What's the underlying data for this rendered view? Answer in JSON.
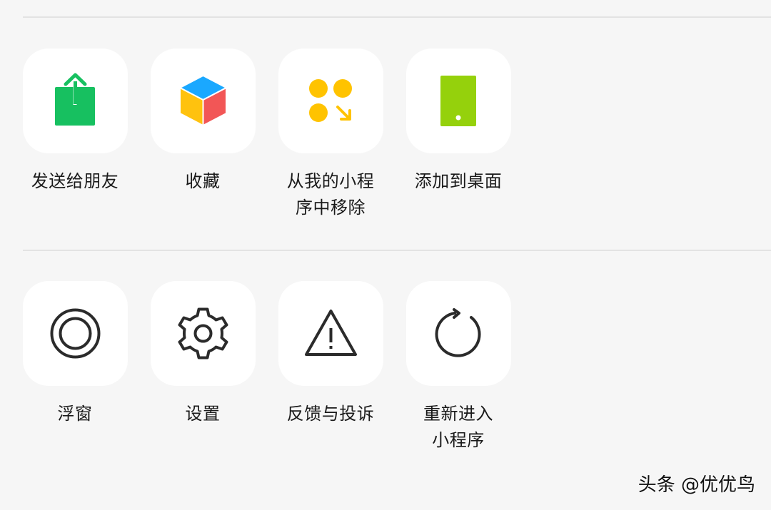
{
  "colors": {
    "share_green": "#17c060",
    "favorite_blue": "#1aa8ff",
    "favorite_yellow": "#ffc20e",
    "favorite_red": "#f25656",
    "remove_yellow": "#ffc300",
    "desktop_green": "#95d10c",
    "icon_stroke": "#2b2b2b"
  },
  "sections": [
    {
      "items": [
        {
          "label": "发送给朋友",
          "icon": "share-icon"
        },
        {
          "label": "收藏",
          "icon": "cube-icon"
        },
        {
          "label": "从我的小程序中移除",
          "label_line1": "从我的小程",
          "label_line2": "序中移除",
          "icon": "mini-program-remove-icon"
        },
        {
          "label": "添加到桌面",
          "icon": "phone-icon"
        }
      ]
    },
    {
      "items": [
        {
          "label": "浮窗",
          "icon": "floating-window-icon"
        },
        {
          "label": "设置",
          "icon": "gear-icon"
        },
        {
          "label": "反馈与投诉",
          "icon": "warning-icon"
        },
        {
          "label": "重新进入小程序",
          "label_line1": "重新进入",
          "label_line2": "小程序",
          "icon": "refresh-icon"
        }
      ]
    }
  ],
  "watermark": "头条 @优优鸟"
}
